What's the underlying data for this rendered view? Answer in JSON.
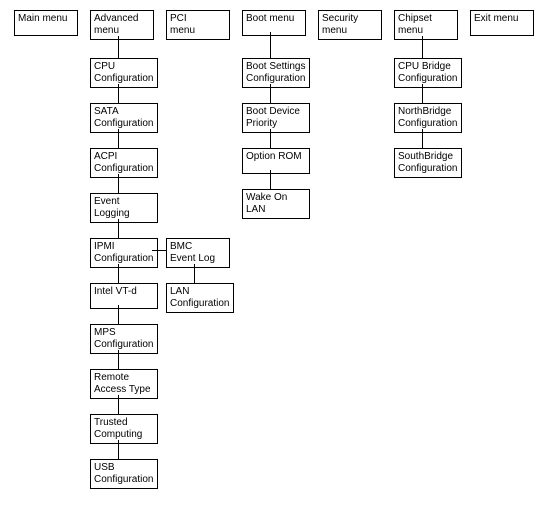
{
  "top": {
    "main": "Main menu",
    "advanced": "Advanced\nmenu",
    "pci": "PCI\nmenu",
    "boot": "Boot  menu",
    "security": "Security\nmenu",
    "chipset": "Chipset\nmenu",
    "exit": "Exit  menu"
  },
  "advanced_children": {
    "cpu": "CPU\nConfiguration",
    "sata": "SATA\nConfiguration",
    "acpi": "ACPI\nConfiguration",
    "event": "Event\nLogging",
    "ipmi": "IPMI\nConfiguration",
    "vtd": "Intel VT-d",
    "mps": "MPS\nConfiguration",
    "remote": "Remote\nAccess Type",
    "trusted": "Trusted\nComputing",
    "usb": "USB\nConfiguration"
  },
  "ipmi_children": {
    "bmc": "BMC\nEvent Log",
    "lan": "LAN\nConfiguration"
  },
  "boot_children": {
    "settings": "Boot Settings\nConfiguration",
    "device": "Boot Device\nPriority",
    "rom": "Option ROM",
    "wol": "Wake On\nLAN"
  },
  "chipset_children": {
    "cpu_bridge": "CPU Bridge\nConfiguration",
    "north": "NorthBridge\nConfiguration",
    "south": "SouthBridge\nConfiguration"
  },
  "chart_data": {
    "type": "tree",
    "title": "",
    "nodes": [
      {
        "id": "main",
        "label": "Main menu",
        "children": []
      },
      {
        "id": "advanced",
        "label": "Advanced menu",
        "children": [
          "cpu",
          "sata",
          "acpi",
          "event",
          "ipmi",
          "vtd",
          "mps",
          "remote",
          "trusted",
          "usb"
        ]
      },
      {
        "id": "pci",
        "label": "PCI menu",
        "children": []
      },
      {
        "id": "boot",
        "label": "Boot menu",
        "children": [
          "boot_settings",
          "boot_device",
          "option_rom",
          "wol"
        ]
      },
      {
        "id": "security",
        "label": "Security menu",
        "children": []
      },
      {
        "id": "chipset",
        "label": "Chipset menu",
        "children": [
          "cpu_bridge",
          "north",
          "south"
        ]
      },
      {
        "id": "exit",
        "label": "Exit menu",
        "children": []
      },
      {
        "id": "cpu",
        "label": "CPU Configuration"
      },
      {
        "id": "sata",
        "label": "SATA Configuration"
      },
      {
        "id": "acpi",
        "label": "ACPI Configuration"
      },
      {
        "id": "event",
        "label": "Event Logging"
      },
      {
        "id": "ipmi",
        "label": "IPMI Configuration",
        "children": [
          "bmc",
          "lan"
        ]
      },
      {
        "id": "vtd",
        "label": "Intel VT-d"
      },
      {
        "id": "mps",
        "label": "MPS Configuration"
      },
      {
        "id": "remote",
        "label": "Remote Access Type"
      },
      {
        "id": "trusted",
        "label": "Trusted Computing"
      },
      {
        "id": "usb",
        "label": "USB Configuration"
      },
      {
        "id": "bmc",
        "label": "BMC Event Log"
      },
      {
        "id": "lan",
        "label": "LAN Configuration"
      },
      {
        "id": "boot_settings",
        "label": "Boot Settings Configuration"
      },
      {
        "id": "boot_device",
        "label": "Boot Device Priority"
      },
      {
        "id": "option_rom",
        "label": "Option ROM"
      },
      {
        "id": "wol",
        "label": "Wake On LAN"
      },
      {
        "id": "cpu_bridge",
        "label": "CPU Bridge Configuration"
      },
      {
        "id": "north",
        "label": "NorthBridge Configuration"
      },
      {
        "id": "south",
        "label": "SouthBridge Configuration"
      }
    ]
  }
}
